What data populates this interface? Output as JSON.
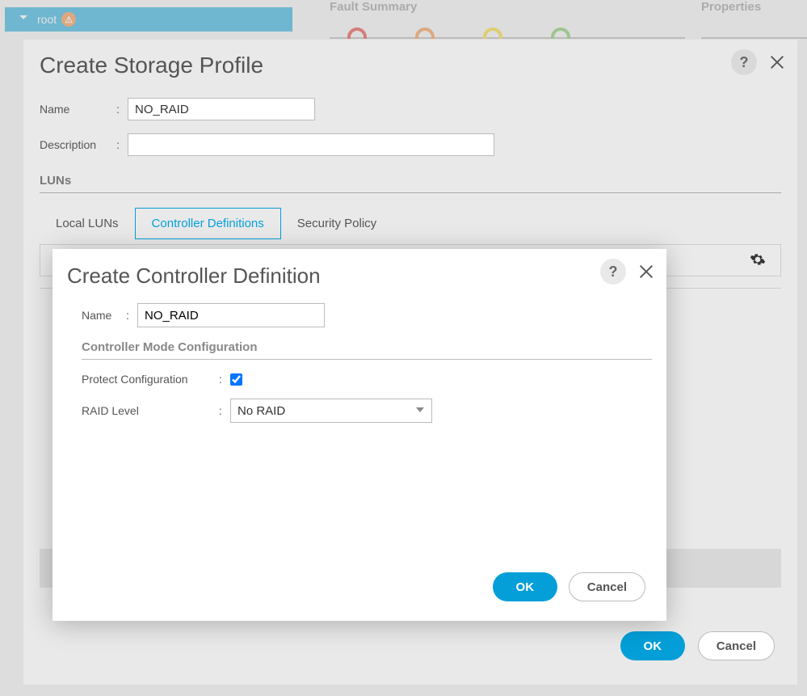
{
  "background": {
    "tree_root_label": "root",
    "tree_root_badge": "⚠",
    "fault_summary_label": "Fault Summary",
    "properties_label": "Properties"
  },
  "outer_dialog": {
    "title": "Create Storage Profile",
    "name_label": "Name",
    "name_value": "NO_RAID",
    "description_label": "Description",
    "description_value": "",
    "luns_section": "LUNs",
    "tabs": {
      "local": "Local LUNs",
      "ctrl": "Controller Definitions",
      "security": "Security Policy"
    },
    "ok_label": "OK",
    "cancel_label": "Cancel"
  },
  "inner_dialog": {
    "title": "Create Controller Definition",
    "name_label": "Name",
    "name_value": "NO_RAID",
    "mode_section": "Controller Mode Configuration",
    "protect_label": "Protect Configuration",
    "protect_checked": true,
    "raid_label": "RAID Level",
    "raid_value": "No RAID",
    "ok_label": "OK",
    "cancel_label": "Cancel"
  }
}
